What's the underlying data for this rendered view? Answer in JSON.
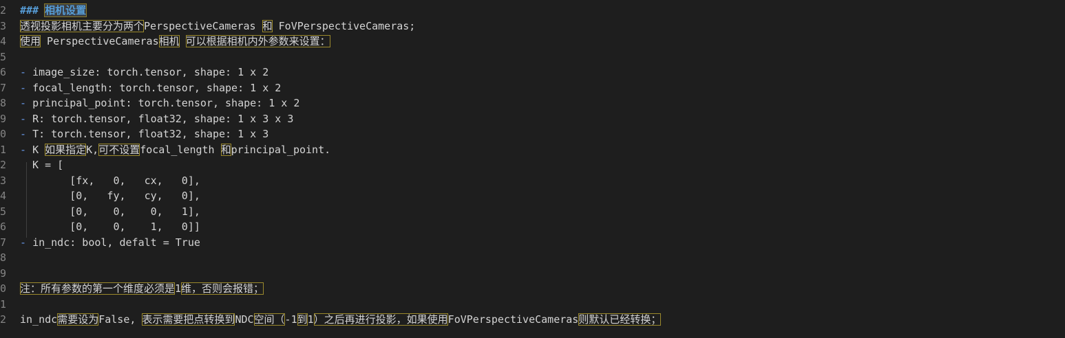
{
  "editor": {
    "lines": [
      {
        "num": "2",
        "parts": [
          {
            "t": "### ",
            "c": "mdhead"
          },
          {
            "t": "相机设置",
            "c": "mdhead-hl"
          }
        ]
      },
      {
        "num": "3",
        "parts": [
          {
            "t": "透视投影相机主要分为两个",
            "c": "hl"
          },
          {
            "t": "PerspectiveCameras "
          },
          {
            "t": "和",
            "c": "hl"
          },
          {
            "t": " FoVPerspectiveCameras;"
          }
        ]
      },
      {
        "num": "4",
        "parts": [
          {
            "t": "使用",
            "c": "hl"
          },
          {
            "t": " PerspectiveCameras"
          },
          {
            "t": "相机",
            "c": "hl"
          },
          {
            "t": " "
          },
          {
            "t": "可以根据相机内外参数来设置：",
            "c": "hl"
          }
        ]
      },
      {
        "num": "5",
        "parts": []
      },
      {
        "num": "6",
        "parts": [
          {
            "t": "- ",
            "c": "dash"
          },
          {
            "t": "image_size: torch.tensor, shape: 1 x 2"
          }
        ]
      },
      {
        "num": "7",
        "parts": [
          {
            "t": "- ",
            "c": "dash"
          },
          {
            "t": "focal_length: torch.tensor, shape: 1 x 2"
          }
        ]
      },
      {
        "num": "8",
        "parts": [
          {
            "t": "- ",
            "c": "dash"
          },
          {
            "t": "principal_point: torch.tensor, shape: 1 x 2"
          }
        ]
      },
      {
        "num": "9",
        "parts": [
          {
            "t": "- ",
            "c": "dash"
          },
          {
            "t": "R: torch.tensor, float32, shape: 1 x 3 x 3"
          }
        ]
      },
      {
        "num": "0",
        "parts": [
          {
            "t": "- ",
            "c": "dash"
          },
          {
            "t": "T: torch.tensor, float32, shape: 1 x 3"
          }
        ]
      },
      {
        "num": "1",
        "parts": [
          {
            "t": "- ",
            "c": "dash"
          },
          {
            "t": "K "
          },
          {
            "t": "如果指定",
            "c": "hl"
          },
          {
            "t": "K,"
          },
          {
            "t": "可不设置",
            "c": "hl"
          },
          {
            "t": "focal_length "
          },
          {
            "t": "和",
            "c": "hl"
          },
          {
            "t": "principal_point."
          }
        ]
      },
      {
        "num": "2",
        "parts": [
          {
            "t": "  K = ["
          }
        ]
      },
      {
        "num": "3",
        "parts": [
          {
            "t": "        [fx,   0,   cx,   0],"
          }
        ]
      },
      {
        "num": "4",
        "parts": [
          {
            "t": "        [0,   fy,   cy,   0],"
          }
        ]
      },
      {
        "num": "5",
        "parts": [
          {
            "t": "        [0,    0,    0,   1],"
          }
        ]
      },
      {
        "num": "6",
        "parts": [
          {
            "t": "        [0,    0,    1,   0]]"
          }
        ]
      },
      {
        "num": "7",
        "parts": [
          {
            "t": "- ",
            "c": "dash"
          },
          {
            "t": "in_ndc: bool, defalt = True"
          }
        ]
      },
      {
        "num": "8",
        "parts": []
      },
      {
        "num": "9",
        "parts": []
      },
      {
        "num": "0",
        "parts": [
          {
            "t": "注：所有参数的第一个维度必须是",
            "c": "hl"
          },
          {
            "t": "1"
          },
          {
            "t": "维，否则会报错；",
            "c": "hl"
          }
        ]
      },
      {
        "num": "1",
        "parts": []
      },
      {
        "num": "2",
        "parts": [
          {
            "t": "in_ndc"
          },
          {
            "t": "需要设为",
            "c": "hl"
          },
          {
            "t": "False, "
          },
          {
            "t": "表示需要把点转换到",
            "c": "hl"
          },
          {
            "t": "NDC"
          },
          {
            "t": "空间（",
            "c": "hl"
          },
          {
            "t": "-1"
          },
          {
            "t": "到",
            "c": "hl"
          },
          {
            "t": "1"
          },
          {
            "t": "）之后再进行投影，如果使用",
            "c": "hl"
          },
          {
            "t": "FoVPerspectiveCameras"
          },
          {
            "t": "则默认已经转换；",
            "c": "hl"
          }
        ]
      }
    ]
  }
}
